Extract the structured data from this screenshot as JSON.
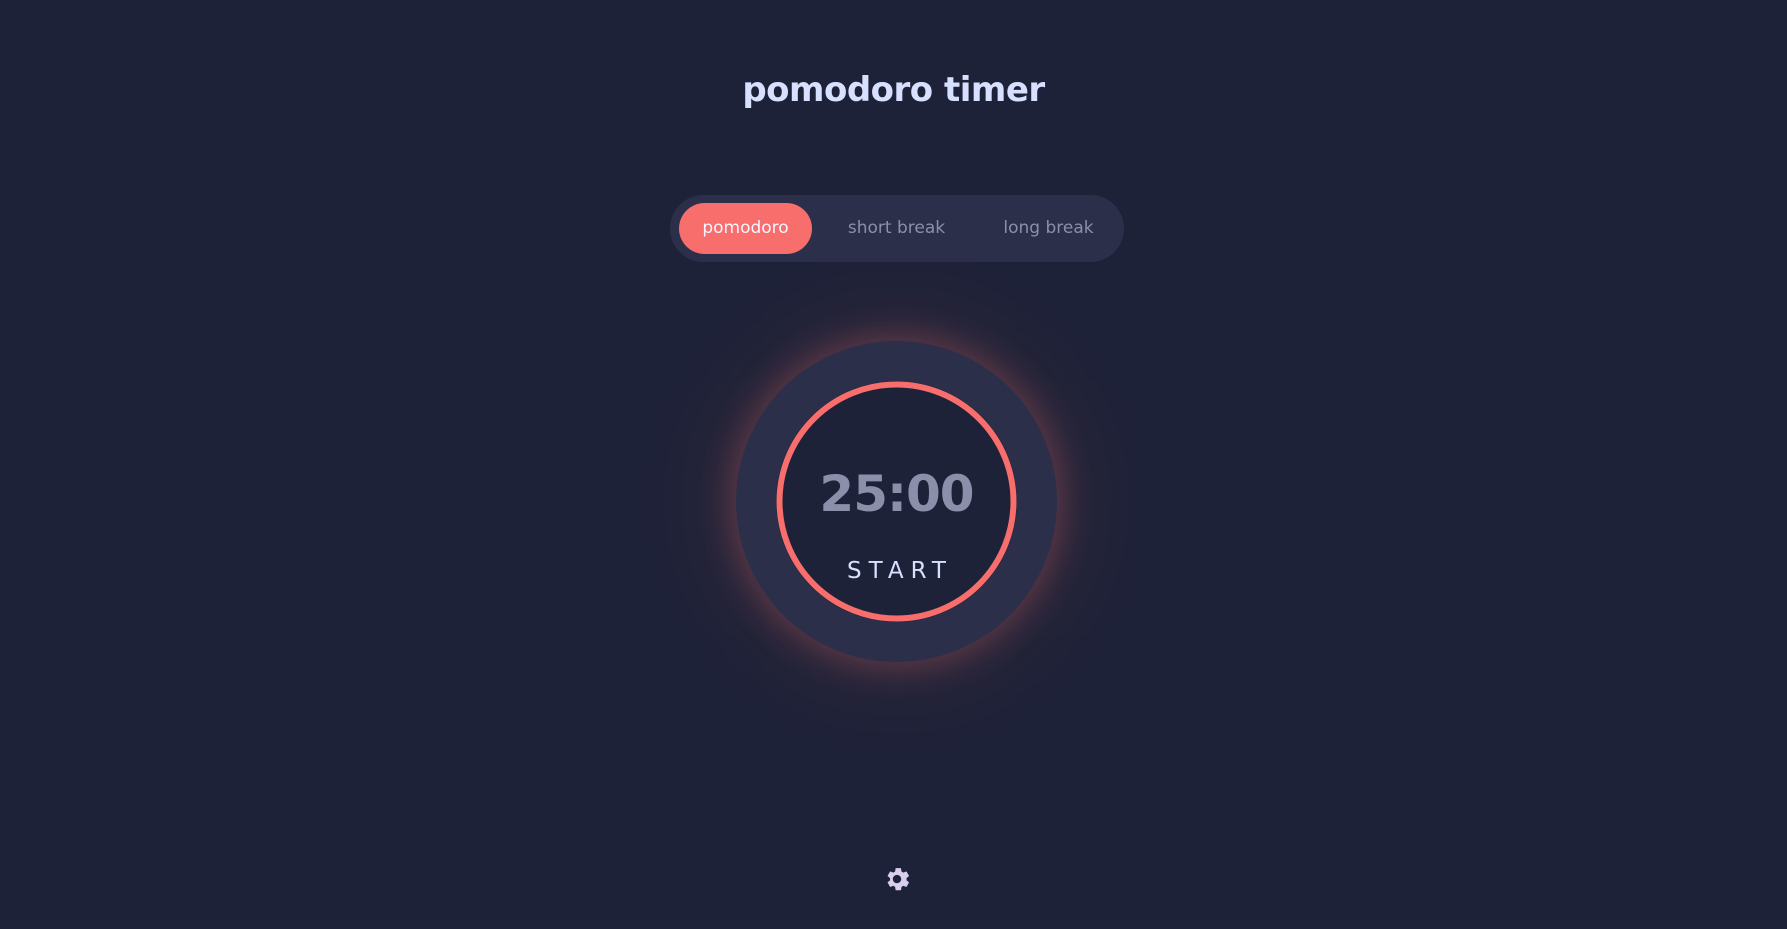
{
  "app": {
    "title": "pomodoro timer"
  },
  "modes": {
    "items": [
      {
        "label": "pomodoro",
        "active": true
      },
      {
        "label": "short break",
        "active": false
      },
      {
        "label": "long break",
        "active": false
      }
    ]
  },
  "timer": {
    "time": "25:00",
    "action_label": "START",
    "progress": 1.0
  },
  "settings": {
    "icon": "gear-icon"
  },
  "colors": {
    "background": "#1e2238",
    "panel": "#2b2f4a",
    "accent": "#f76e6c",
    "text_light": "#d7e0fe",
    "text_muted": "#8b8fa9"
  }
}
